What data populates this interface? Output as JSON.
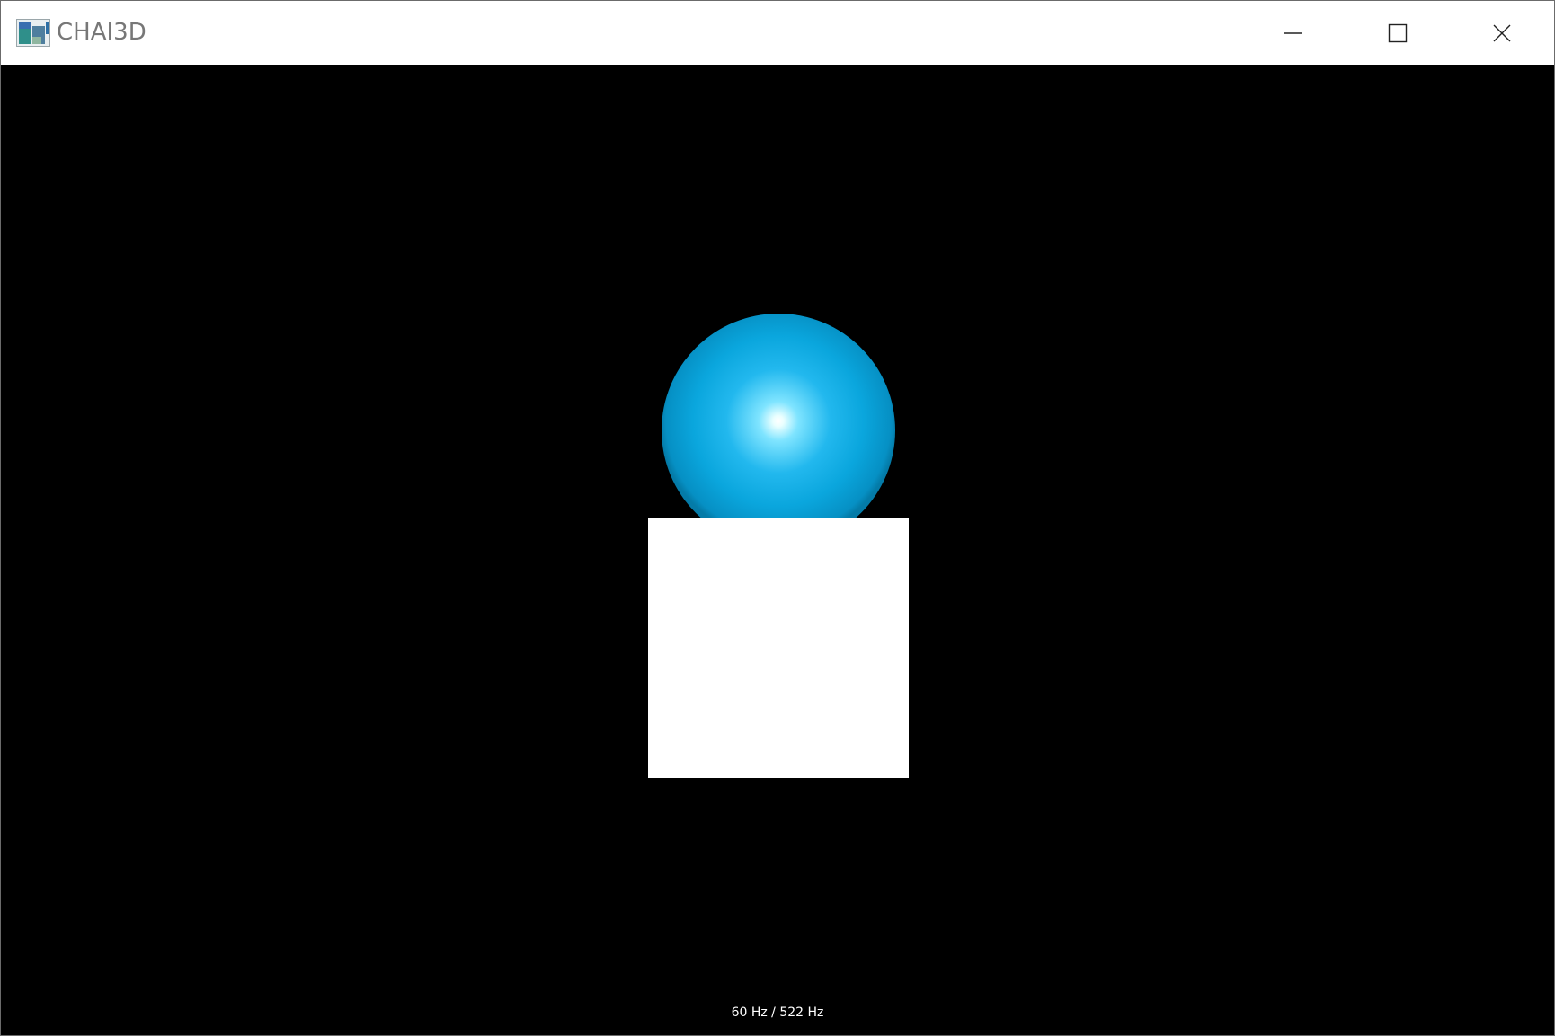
{
  "window": {
    "title": "CHAI3D",
    "app_icon": "chai3d-app-icon",
    "controls": {
      "minimize_icon": "minimize-icon",
      "maximize_icon": "maximize-icon",
      "close_icon": "close-icon"
    }
  },
  "scene": {
    "background_color": "#000000",
    "sphere_color": "#0aa6dd",
    "box_color": "#ffffff"
  },
  "status": {
    "rates": "60 Hz / 522 Hz"
  }
}
